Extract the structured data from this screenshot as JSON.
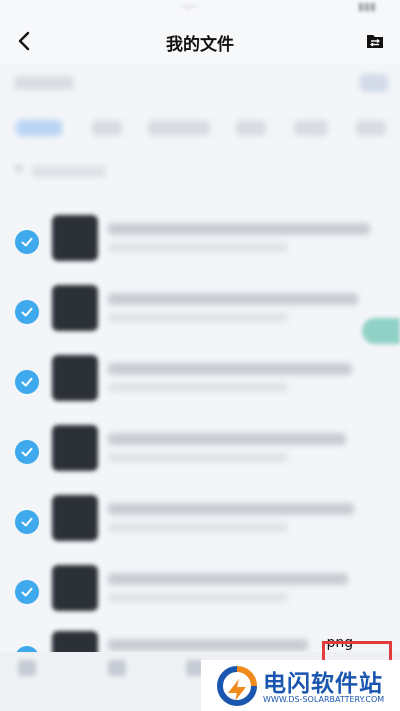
{
  "header": {
    "title": "我的文件",
    "back_icon": "chevron-left-icon",
    "transfer_icon": "transfer-list-icon"
  },
  "file_list": {
    "rows": [
      {
        "checked": true
      },
      {
        "checked": true
      },
      {
        "checked": true
      },
      {
        "checked": true
      },
      {
        "checked": true
      },
      {
        "checked": true
      },
      {
        "checked": true,
        "name_tail": ".png"
      }
    ]
  },
  "watermark": {
    "title": "电闪软件站",
    "url": "WWW.DS-SOLARBATTERY.COM"
  },
  "colors": {
    "accent_check": "#3ea9ec",
    "highlight_frame": "#e23b3b",
    "watermark_brand": "#1a56b0"
  }
}
